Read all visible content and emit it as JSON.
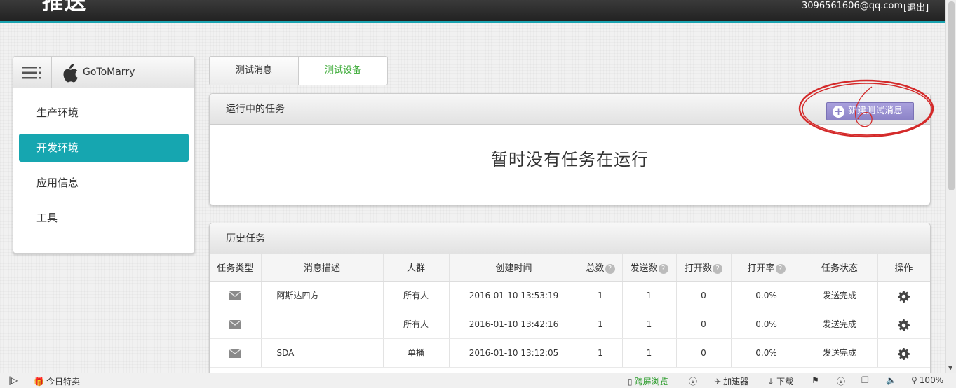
{
  "header": {
    "logo_text": "推送",
    "user_email": "3096561606@qq.com",
    "logout_label": "[退出]"
  },
  "sidebar": {
    "app_name": "GoToMarry",
    "items": [
      {
        "label": "生产环境",
        "active": false
      },
      {
        "label": "开发环境",
        "active": true
      },
      {
        "label": "应用信息",
        "active": false
      },
      {
        "label": "工具",
        "active": false
      }
    ]
  },
  "tabs": [
    {
      "label": "测试消息",
      "active": true
    },
    {
      "label": "测试设备",
      "active": false
    }
  ],
  "running_panel": {
    "title": "运行中的任务",
    "new_button_label": "新建测试消息",
    "empty_message": "暂时没有任务在运行"
  },
  "history_panel": {
    "title": "历史任务",
    "columns": [
      "任务类型",
      "消息描述",
      "人群",
      "创建时间",
      "总数",
      "发送数",
      "打开数",
      "打开率",
      "任务状态",
      "操作"
    ],
    "rows": [
      {
        "type_icon": "mail-icon",
        "desc": "阿斯达四方",
        "audience": "所有人",
        "created": "2016-01-10 13:53:19",
        "total": "1",
        "sent": "1",
        "opened": "0",
        "open_rate": "0.0%",
        "status": "发送完成",
        "action_icon": "gear-icon"
      },
      {
        "type_icon": "mail-icon",
        "desc": "",
        "audience": "所有人",
        "created": "2016-01-10 13:42:16",
        "total": "1",
        "sent": "1",
        "opened": "0",
        "open_rate": "0.0%",
        "status": "发送完成",
        "action_icon": "gear-icon"
      },
      {
        "type_icon": "mail-icon",
        "desc": "SDA",
        "audience": "单播",
        "created": "2016-01-10 13:12:05",
        "total": "1",
        "sent": "1",
        "opened": "0",
        "open_rate": "0.0%",
        "status": "发送完成",
        "action_icon": "gear-icon"
      }
    ]
  },
  "statusbar": {
    "today_deals": "今日特卖",
    "cross_screen": "跨屏浏览",
    "accelerator": "加速器",
    "download": "下载",
    "zoom": "100%"
  },
  "colors": {
    "accent": "#16a6b0",
    "button_purple": "#8c83c7",
    "tab_green": "#3aaa35",
    "annotation_red": "#d42a2a"
  }
}
